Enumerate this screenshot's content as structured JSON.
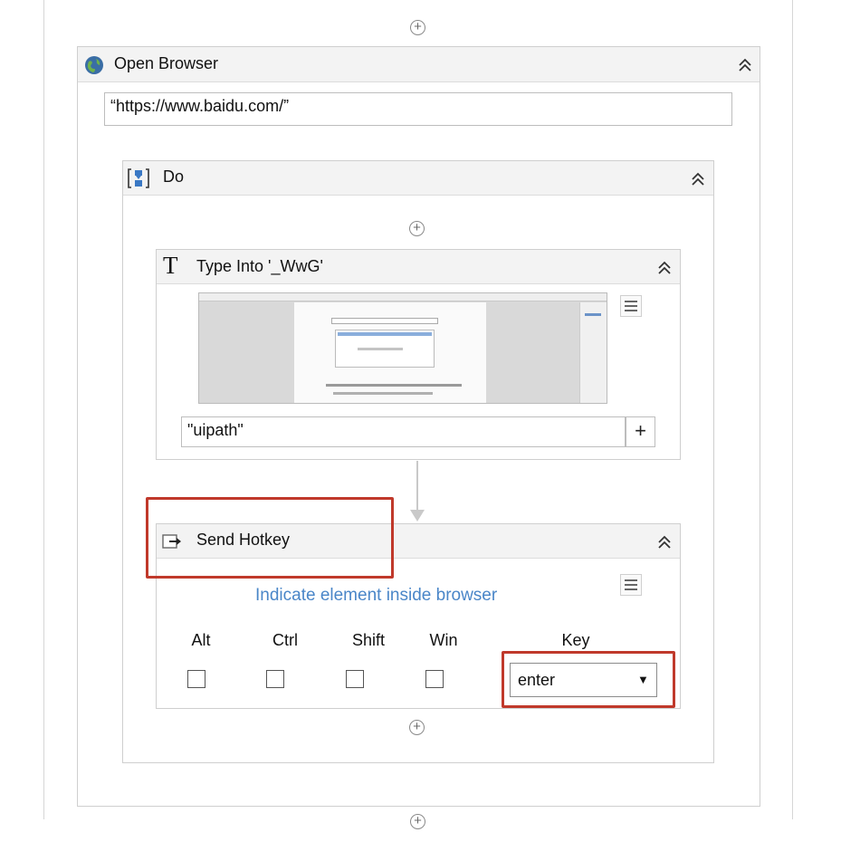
{
  "open_browser": {
    "title": "Open Browser",
    "url_value": "“https://www.baidu.com/”"
  },
  "do_block": {
    "title": "Do"
  },
  "type_into": {
    "title": "Type Into '_WwG'",
    "text_value": "\"uipath\"",
    "add_label": "+"
  },
  "send_hotkey": {
    "title": "Send Hotkey",
    "indicate_link": "Indicate element inside browser",
    "modifiers": [
      "Alt",
      "Ctrl",
      "Shift",
      "Win"
    ],
    "key_label": "Key",
    "key_value": "enter",
    "key_dropdown_icon": "▼"
  },
  "icons": {
    "add_activity": "plus-circle-icon",
    "collapse": "double-chevron-up-icon",
    "globe": "globe-icon",
    "sequence": "sequence-icon",
    "type_into": "text-T-icon",
    "send_hotkey": "keyboard-arrow-icon",
    "menu": "hamburger-menu-icon"
  },
  "colors": {
    "highlight": "#c0392b",
    "link": "#4a86c8",
    "header_bg": "#f3f3f3"
  }
}
